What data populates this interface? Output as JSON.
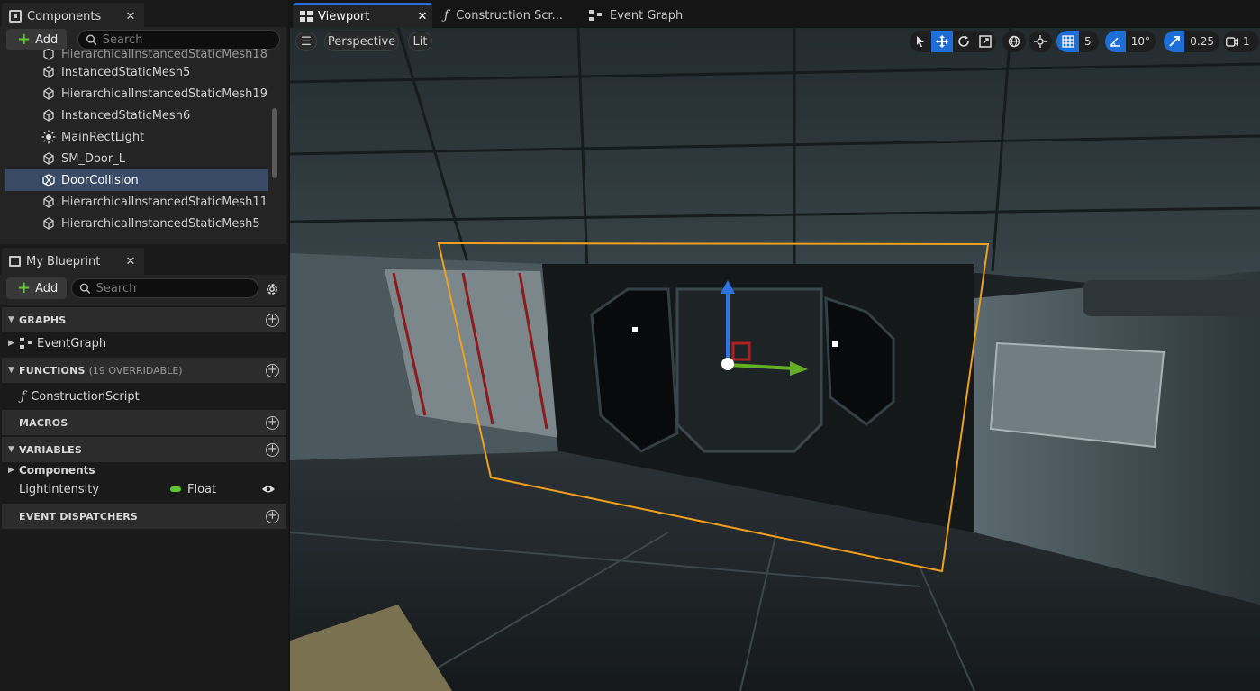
{
  "components_panel": {
    "title": "Components",
    "add_label": "Add",
    "search_placeholder": "Search",
    "items": [
      {
        "label": "InstancedStaticMesh5",
        "icon": "static-mesh-icon"
      },
      {
        "label": "HierarchicalInstancedStaticMesh19",
        "icon": "static-mesh-icon"
      },
      {
        "label": "InstancedStaticMesh6",
        "icon": "static-mesh-icon"
      },
      {
        "label": "MainRectLight",
        "icon": "light-icon"
      },
      {
        "label": "SM_Door_L",
        "icon": "static-mesh-icon"
      },
      {
        "label": "DoorCollision",
        "icon": "collision-icon",
        "selected": true
      },
      {
        "label": "HierarchicalInstancedStaticMesh11",
        "icon": "static-mesh-icon"
      },
      {
        "label": "HierarchicalInstancedStaticMesh5",
        "icon": "static-mesh-icon"
      }
    ]
  },
  "blueprint_panel": {
    "title": "My Blueprint",
    "add_label": "Add",
    "search_placeholder": "Search",
    "graphs_title": "GRAPHS",
    "event_graph": "EventGraph",
    "functions_title": "FUNCTIONS",
    "functions_sub": "(19 OVERRIDABLE)",
    "construction_script": "ConstructionScript",
    "macros_title": "MACROS",
    "variables_title": "VARIABLES",
    "components_group": "Components",
    "variable_name": "LightIntensity",
    "variable_type": "Float",
    "variable_type_color": "#5fc830",
    "dispatchers_title": "EVENT DISPATCHERS"
  },
  "tabs": {
    "viewport": "Viewport",
    "construction": "Construction Scr...",
    "event_graph": "Event Graph"
  },
  "viewport": {
    "perspective": "Perspective",
    "lit": "Lit",
    "grid_snap": "5",
    "rotation_snap": "10°",
    "scale_snap": "0.25",
    "camera_speed": "1",
    "accent": "#1e6ed8",
    "selection_color": "#f0a020"
  }
}
